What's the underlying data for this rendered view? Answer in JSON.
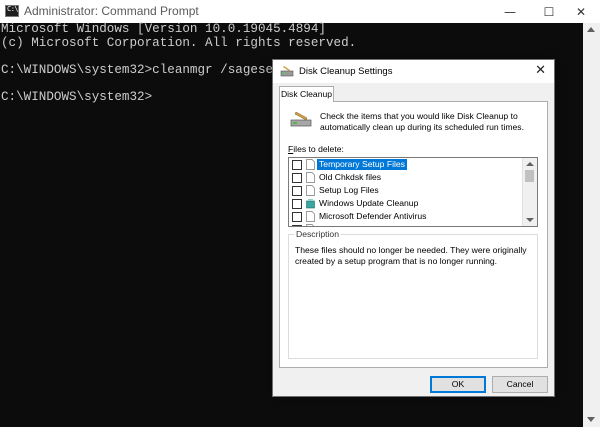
{
  "console_window": {
    "title": "Administrator: Command Prompt",
    "icon_text": "C:\\",
    "minimize": "—",
    "maximize": "☐",
    "close": "✕",
    "lines": [
      "Microsoft Windows [Version 10.0.19045.4894]",
      "(c) Microsoft Corporation. All rights reserved.",
      "",
      "C:\\WINDOWS\\system32>cleanmgr /sageset:1",
      "",
      "C:\\WINDOWS\\system32>"
    ]
  },
  "dialog": {
    "title": "Disk Cleanup Settings",
    "close": "✕",
    "tab_label": "Disk Cleanup",
    "header_text": "Check the items that you would like Disk Cleanup to automatically clean up during its scheduled run times.",
    "files_label_prefix": "F",
    "files_label_rest": "iles to delete:",
    "files": [
      {
        "label": "Temporary Setup Files",
        "checked": false,
        "selected": true,
        "icon": "file-icon"
      },
      {
        "label": "Old Chkdsk files",
        "checked": false,
        "selected": false,
        "icon": "file-icon"
      },
      {
        "label": "Setup Log Files",
        "checked": false,
        "selected": false,
        "icon": "file-icon"
      },
      {
        "label": "Windows Update Cleanup",
        "checked": false,
        "selected": false,
        "icon": "windows-update-icon"
      },
      {
        "label": "Microsoft Defender Antivirus",
        "checked": false,
        "selected": false,
        "icon": "file-icon"
      },
      {
        "label": "",
        "checked": false,
        "selected": false,
        "icon": "file-icon"
      }
    ],
    "description_legend": "Description",
    "description_text": "These files should no longer be needed. They were originally created by a setup program that is no longer running.",
    "ok_label": "OK",
    "cancel_label": "Cancel"
  },
  "colors": {
    "console_bg": "#0c0c0c",
    "console_fg": "#cccccc",
    "selection": "#0078d7"
  }
}
